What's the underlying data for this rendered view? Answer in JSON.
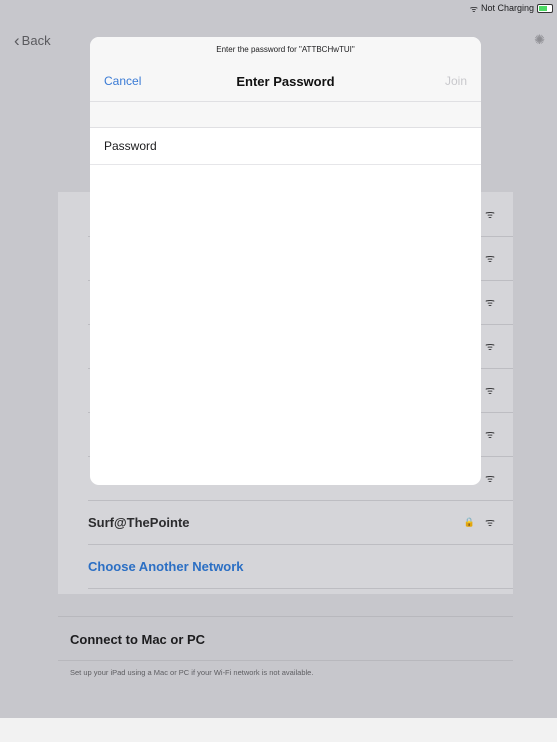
{
  "status_bar": {
    "wifi_icon": "wifi-icon",
    "text": "Not Charging",
    "battery_icon": "battery-icon"
  },
  "nav": {
    "back_label": "Back"
  },
  "modal": {
    "prompt": "Enter the password for \"ATTBCHwTUI\"",
    "cancel_label": "Cancel",
    "title": "Enter Password",
    "join_label": "Join",
    "password_label": "Password",
    "password_value": ""
  },
  "networks": [
    {
      "name": "",
      "locked": false
    },
    {
      "name": "",
      "locked": false
    },
    {
      "name": "",
      "locked": false
    },
    {
      "name": "",
      "locked": false
    },
    {
      "name": "",
      "locked": false
    },
    {
      "name": "",
      "locked": false
    },
    {
      "name": "",
      "locked": true
    },
    {
      "name": "Surf@ThePointe",
      "locked": true
    }
  ],
  "choose_another": "Choose Another Network",
  "connect": {
    "title": "Connect to Mac or PC",
    "description": "Set up your iPad using a Mac or PC if your Wi-Fi network is not available."
  },
  "colors": {
    "accent": "#3a7bd5",
    "disabled": "#c8c8cc",
    "dim_background": "#c7c7cc"
  }
}
